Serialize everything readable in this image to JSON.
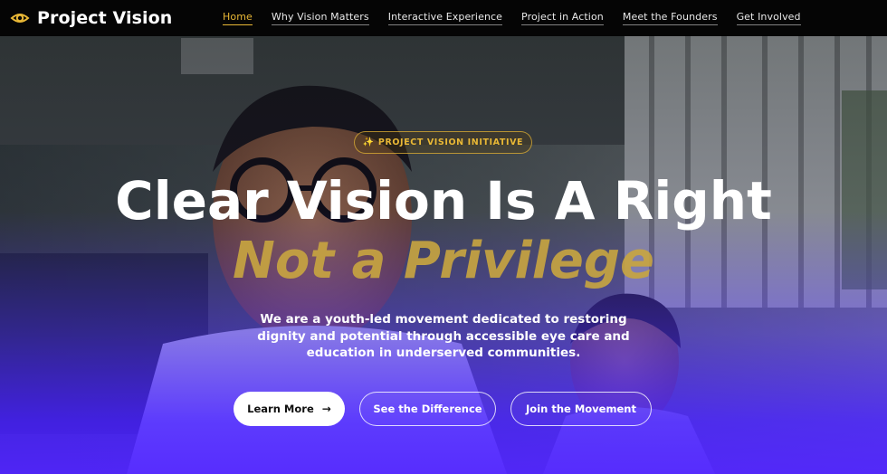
{
  "brand": {
    "name": "Project Vision",
    "icon": "eye-icon",
    "accent": "#e9b836"
  },
  "nav": {
    "items": [
      {
        "label": "Home",
        "active": true
      },
      {
        "label": "Why Vision Matters",
        "active": false
      },
      {
        "label": "Interactive Experience",
        "active": false
      },
      {
        "label": "Project in Action",
        "active": false
      },
      {
        "label": "Meet the Founders",
        "active": false
      },
      {
        "label": "Get Involved",
        "active": false
      }
    ]
  },
  "hero": {
    "badge": {
      "icon": "sparkle-icon",
      "label": "PROJECT VISION INITIATIVE"
    },
    "headline": "Clear Vision Is A Right",
    "subheadline": "Not a Privilege",
    "description": "We are a youth-led movement dedicated to restoring dignity and potential through accessible eye care and education in underserved communities.",
    "buttons": {
      "learn_more": "Learn More",
      "learn_more_icon": "arrow-right-icon",
      "see_difference": "See the Difference",
      "join": "Join the Movement"
    }
  },
  "colors": {
    "header_bg": "#050505",
    "accent": "#e9b836",
    "gradient_end": "#5023ff"
  }
}
